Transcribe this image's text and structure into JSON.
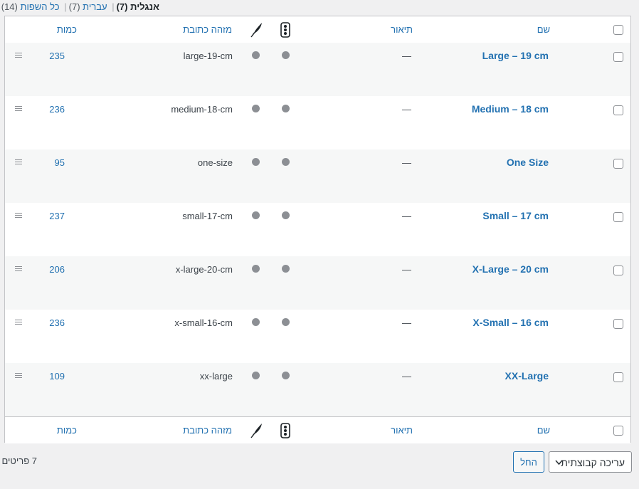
{
  "language_filter": {
    "current_label": "אנגלית",
    "current_count": "(7)",
    "hebrew_label": "עברית",
    "hebrew_count": "(7)",
    "all_label": "כל השפות",
    "all_count": "(14)"
  },
  "columns": {
    "name": "שם",
    "description": "תיאור",
    "slug": "מזהה כתובת",
    "quantity": "כמות",
    "status_icon": "traffic-light-icon",
    "translate_icon": "feather-icon"
  },
  "rows": [
    {
      "name": "Large – 19 cm",
      "description": "—",
      "slug": "large-19-cm",
      "count": "235"
    },
    {
      "name": "Medium – 18 cm",
      "description": "—",
      "slug": "medium-18-cm",
      "count": "236"
    },
    {
      "name": "One Size",
      "description": "—",
      "slug": "one-size",
      "count": "95"
    },
    {
      "name": "Small – 17 cm",
      "description": "—",
      "slug": "small-17-cm",
      "count": "237"
    },
    {
      "name": "X-Large – 20 cm",
      "description": "—",
      "slug": "x-large-20-cm",
      "count": "206"
    },
    {
      "name": "X-Small – 16 cm",
      "description": "—",
      "slug": "x-small-16-cm",
      "count": "236"
    },
    {
      "name": "XX-Large",
      "description": "—",
      "slug": "xx-large",
      "count": "109"
    }
  ],
  "bulk_actions": {
    "select_value": "עריכה קבוצתית",
    "apply_label": "החל"
  },
  "items_count": "7 פריטים",
  "colors": {
    "link": "#2271b1",
    "border": "#c3c4c7",
    "dot": "#8c8f94"
  }
}
